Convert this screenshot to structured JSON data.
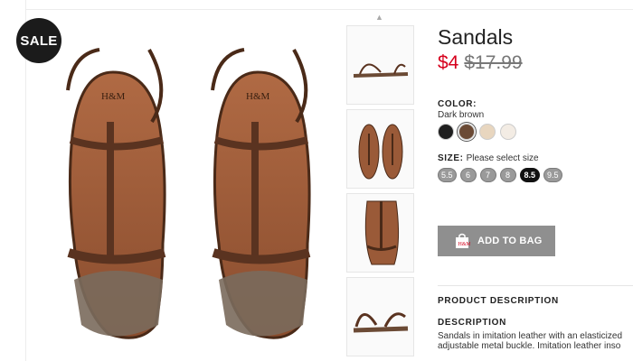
{
  "badge": {
    "sale": "SALE"
  },
  "product": {
    "title": "Sandals",
    "price_sale": "$4",
    "price_original": "$17.99"
  },
  "color": {
    "label": "COLOR:",
    "selected": "Dark brown",
    "swatches": [
      "#1f1f1f",
      "#6b4a35",
      "#e8d6bf",
      "#f3ece4"
    ],
    "selected_index": 1
  },
  "size": {
    "label": "SIZE:",
    "hint": "Please select size",
    "options": [
      "5.5",
      "6",
      "7",
      "8",
      "8.5",
      "9.5"
    ],
    "selected": "8.5"
  },
  "actions": {
    "add_to_bag": "ADD TO BAG"
  },
  "description": {
    "heading": "PRODUCT DESCRIPTION",
    "subheading": "DESCRIPTION",
    "lines": [
      "Sandals in imitation leather with an elasticized",
      "adjustable metal buckle. Imitation leather inso"
    ]
  },
  "colors": {
    "sale_price": "#d6001c",
    "button": "#8f8f8f",
    "badge": "#1b1b1b"
  }
}
